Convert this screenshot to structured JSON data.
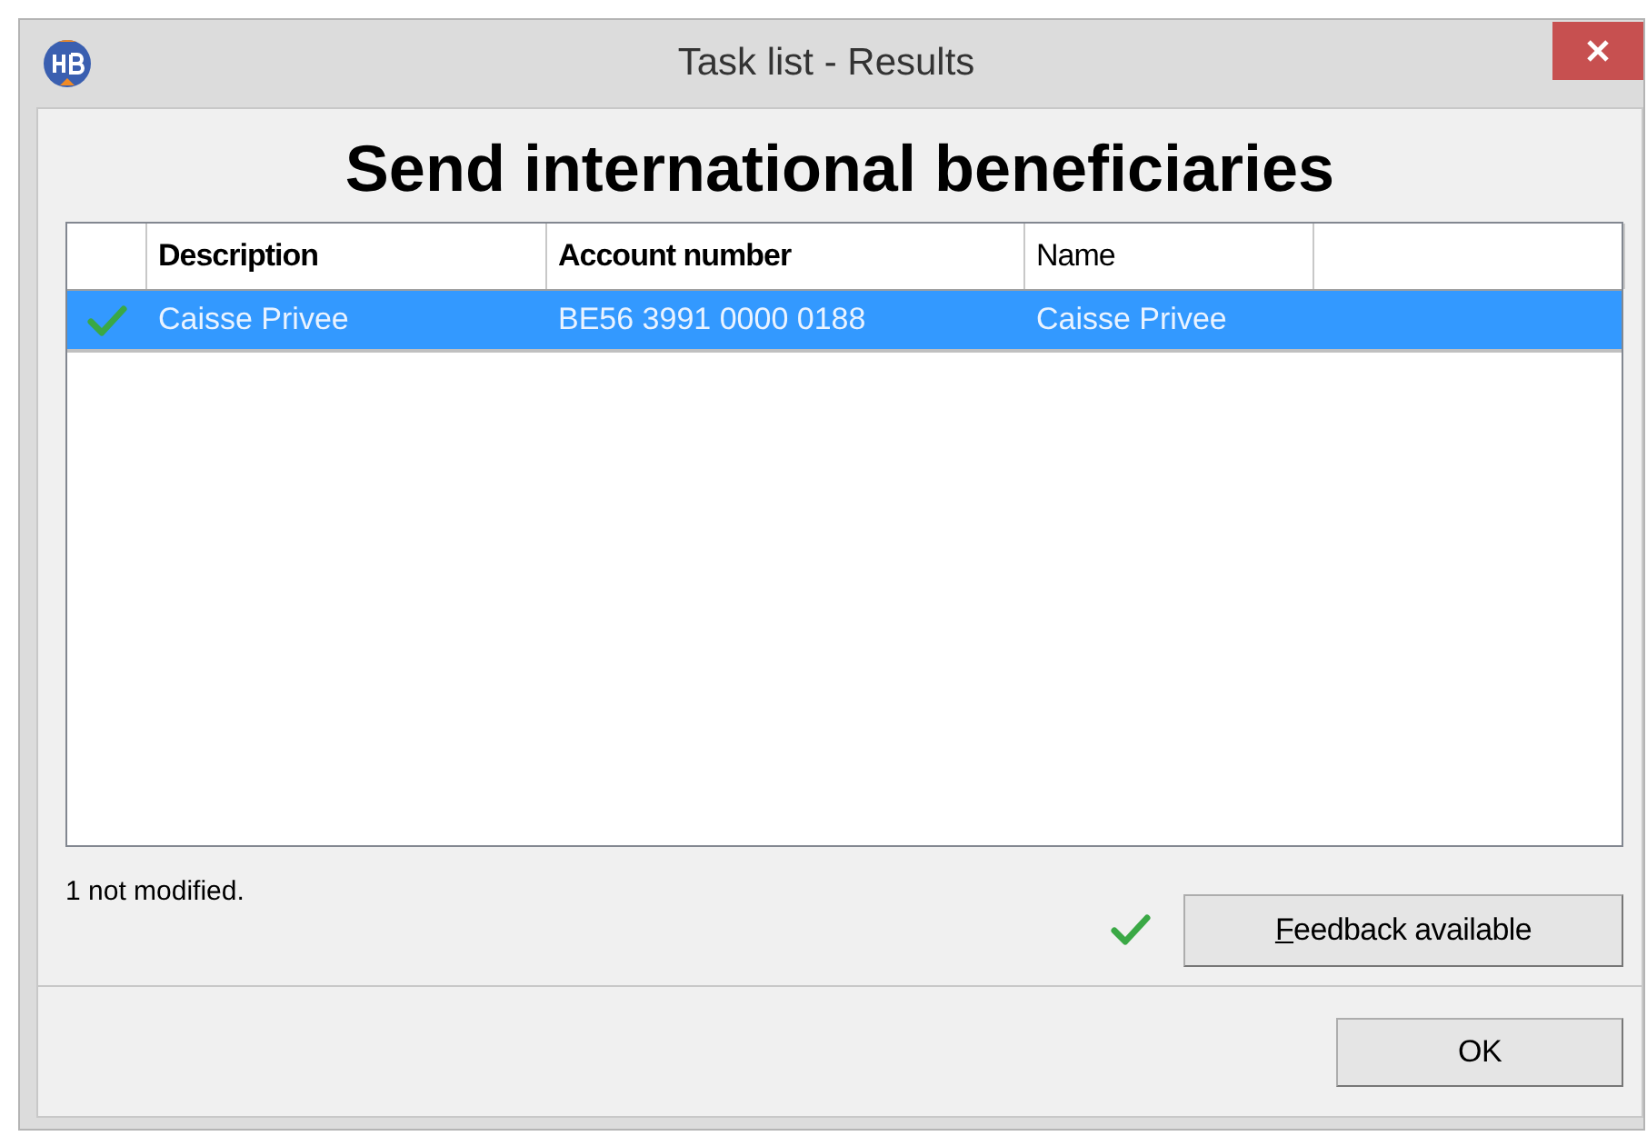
{
  "window": {
    "title": "Task list - Results"
  },
  "heading": "Send international beneficiaries",
  "table": {
    "columns": [
      {
        "label": "Description",
        "bold": true
      },
      {
        "label": "Account number",
        "bold": true
      },
      {
        "label": "Name",
        "bold": false
      }
    ],
    "rows": [
      {
        "selected": true,
        "ok": true,
        "cells": [
          "Caisse Privee",
          "BE56 3991 0000 0188",
          "Caisse Privee"
        ]
      }
    ]
  },
  "status_text": "1 not modified.",
  "feedback": {
    "ok": true,
    "button": "Feedback available"
  },
  "buttons": [
    "OK"
  ]
}
